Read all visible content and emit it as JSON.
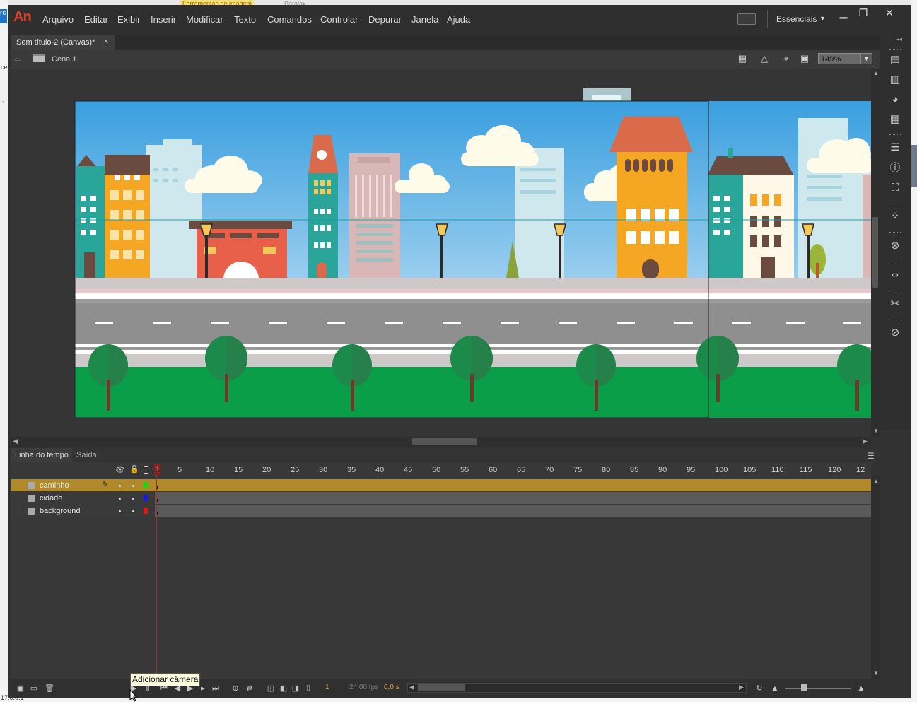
{
  "desktop": {
    "top_tab_1": "Ferramentas de imagem",
    "top_tab_2": "Paralax",
    "side_text_1": "rc",
    "side_text_2": "ce",
    "side_text_3": "17.0.0.1"
  },
  "app": {
    "logo": "An",
    "menu": [
      "Arquivo",
      "Editar",
      "Exibir",
      "Inserir",
      "Modificar",
      "Texto",
      "Comandos",
      "Controlar",
      "Depurar",
      "Janela",
      "Ajuda"
    ],
    "workspace": "Essenciais",
    "window_controls": [
      "minimize",
      "maximize",
      "close"
    ]
  },
  "document": {
    "tab_label": "Sem título-2 (Canvas)*",
    "tab_close": "×",
    "scene_label": "Cena 1",
    "zoom": "149%"
  },
  "stage": {
    "sky_top": "#3a9fde",
    "sky_bottom": "#e4f2fb",
    "grass": "#0a9e49",
    "road": "#8f8f8f",
    "sidewalk": "#cfc8c8",
    "tree_green": "#1c8a4a",
    "building_orange": "#f5a623",
    "building_teal": "#2aa59a",
    "building_red": "#e8604a",
    "building_pink": "#d9b7b7",
    "building_light": "#bfe0e6",
    "lamp_color": "#2b2b2b",
    "guide_line_color": "#18a0a8"
  },
  "timeline": {
    "tab_timeline": "Linha do tempo",
    "tab_output": "Saída",
    "frame_numbers": [
      "1",
      "5",
      "10",
      "15",
      "20",
      "25",
      "30",
      "35",
      "40",
      "45",
      "50",
      "55",
      "60",
      "65",
      "70",
      "75",
      "80",
      "85",
      "90",
      "95",
      "100",
      "105",
      "110",
      "115",
      "120",
      "12"
    ],
    "layers": [
      {
        "name": "caminho",
        "color": "#16d616",
        "selected": true
      },
      {
        "name": "cidade",
        "color": "#1919e6",
        "selected": false
      },
      {
        "name": "background",
        "color": "#e01515",
        "selected": false
      }
    ],
    "current_frame": "1",
    "fps": "24,00 fps",
    "time": "0,0 s",
    "tooltip": "Adicionar câmera"
  }
}
